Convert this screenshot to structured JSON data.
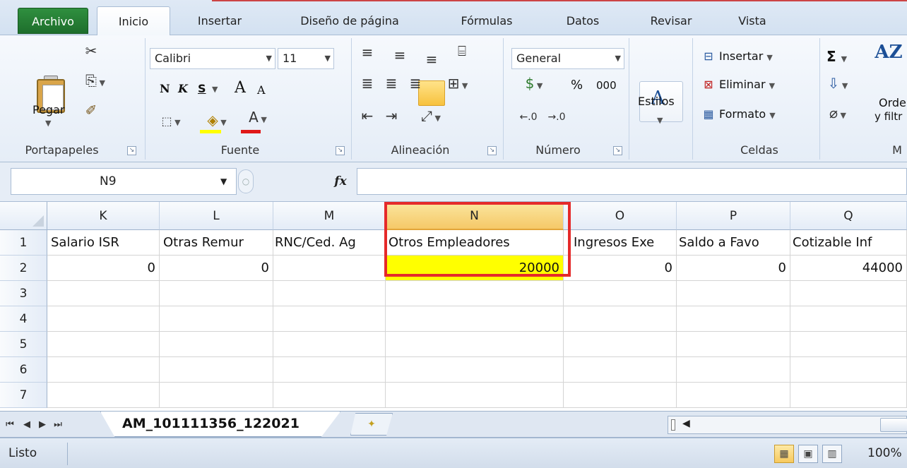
{
  "tabs": {
    "file": "Archivo",
    "home": "Inicio",
    "insert": "Insertar",
    "page_layout": "Diseño de página",
    "formulas": "Fórmulas",
    "data": "Datos",
    "review": "Revisar",
    "view": "Vista"
  },
  "ribbon": {
    "clipboard": {
      "paste": "Pegar",
      "label": "Portapapeles"
    },
    "font": {
      "name": "Calibri",
      "size": "11",
      "bold": "N",
      "italic": "K",
      "underline": "S",
      "grow": "A",
      "shrink": "A",
      "color": "A",
      "label": "Fuente"
    },
    "alignment": {
      "label": "Alineación"
    },
    "number": {
      "format": "General",
      "percent": "%",
      "thousands": "000",
      "label": "Número"
    },
    "styles": {
      "label": "Estilos"
    },
    "cells": {
      "insert": "Insertar",
      "delete": "Eliminar",
      "format": "Formato",
      "label": "Celdas"
    },
    "editing": {
      "sum": "Σ",
      "sort_line1": "Orde",
      "sort_line2": "y filtr",
      "label": "M"
    }
  },
  "formula_bar": {
    "name_box": "N9",
    "fx": "fx",
    "content": ""
  },
  "grid": {
    "columns": [
      "K",
      "L",
      "M",
      "N",
      "O",
      "P",
      "Q"
    ],
    "selected_column": "N",
    "rows": [
      "1",
      "2",
      "3",
      "4",
      "5",
      "6",
      "7"
    ],
    "header_row": [
      "Salario ISR",
      "Otras Remur",
      "RNC/Ced. Ag",
      "Otros Empleadores",
      "Ingresos Exe",
      "Saldo a Favo",
      "Cotizable Inf"
    ],
    "data_row": [
      "0",
      "0",
      "",
      "20000",
      "0",
      "0",
      "44000"
    ],
    "highlight_color": "#ffff00",
    "callout_color": "#e52a2a"
  },
  "sheet_tabs": {
    "active": "AM_101111356_122021"
  },
  "status": {
    "text": "Listo",
    "zoom": "100%"
  }
}
